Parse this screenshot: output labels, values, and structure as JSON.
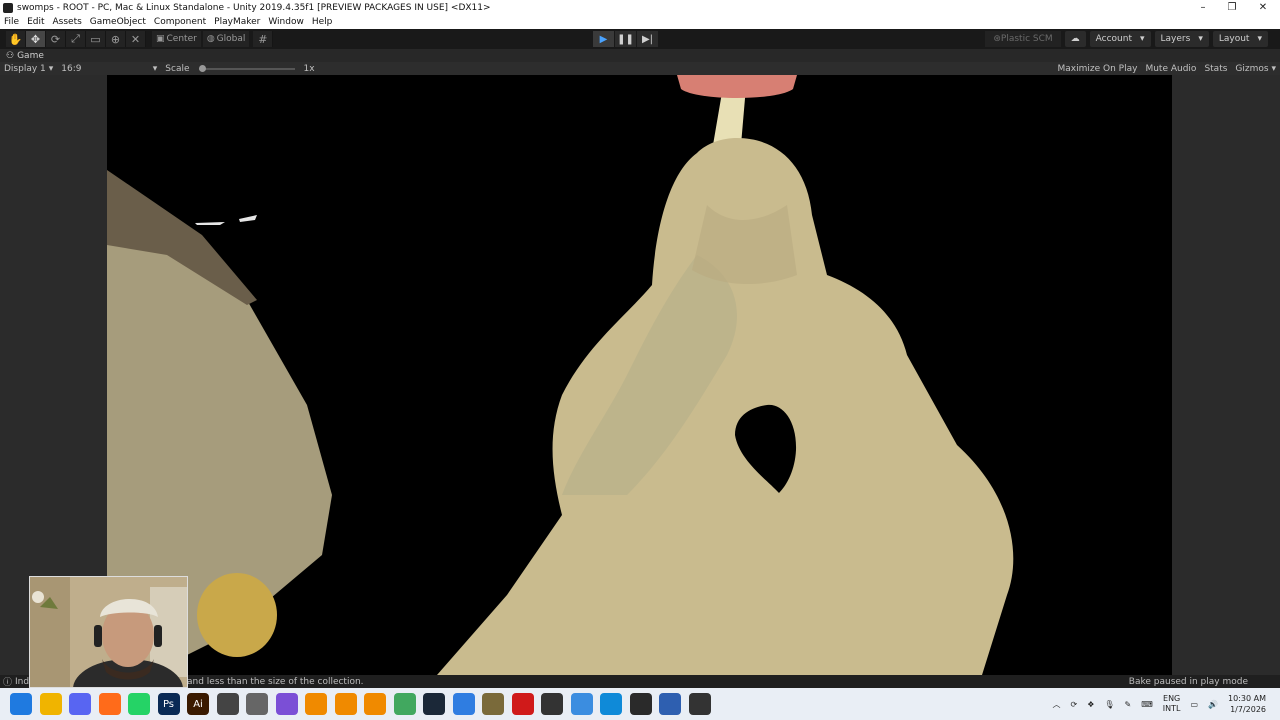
{
  "window": {
    "title": "swomps - ROOT - PC, Mac & Linux Standalone - Unity 2019.4.35f1 [PREVIEW PACKAGES IN USE] <DX11>",
    "controls": [
      "–",
      "❐",
      "✕"
    ]
  },
  "menu": [
    "File",
    "Edit",
    "Assets",
    "GameObject",
    "Component",
    "PlayMaker",
    "Window",
    "Help"
  ],
  "toolbar": {
    "tools": [
      "hand-icon",
      "move-icon",
      "rotate-icon",
      "scale-icon",
      "rect-icon",
      "transform-icon",
      "custom-tool-icon"
    ],
    "pivot": "Center",
    "space": "Global",
    "plastic_scm": "Plastic SCM",
    "account": "Account",
    "layers": "Layers",
    "layout": "Layout"
  },
  "play_mode": {
    "playing": true,
    "paused": false
  },
  "game_tab": {
    "label": "Game"
  },
  "game_bar": {
    "display": "Display 1",
    "aspect": "16:9",
    "scale_label": "Scale",
    "scale_value": "1x",
    "maximize": "Maximize On Play",
    "mute": "Mute Audio",
    "stats": "Stats",
    "gizmos": "Gizmos"
  },
  "status": {
    "message_prefix": "Inde",
    "message": "and less than the size of the collection.",
    "right": "Bake paused in play mode"
  },
  "taskbar": {
    "apps": [
      {
        "name": "start",
        "color": "#1f7ae0"
      },
      {
        "name": "file-explorer",
        "color": "#f0b400"
      },
      {
        "name": "discord",
        "color": "#5865f2"
      },
      {
        "name": "firefox",
        "color": "#ff6b1a"
      },
      {
        "name": "whatsapp",
        "color": "#25d366"
      },
      {
        "name": "photoshop",
        "color": "#0a2a55",
        "label": "Ps"
      },
      {
        "name": "illustrator",
        "color": "#3a1a00",
        "label": "Ai"
      },
      {
        "name": "unity-hub",
        "color": "#444444"
      },
      {
        "name": "unity",
        "color": "#666666"
      },
      {
        "name": "app-purple",
        "color": "#7b4fd6"
      },
      {
        "name": "blender",
        "color": "#f08a00"
      },
      {
        "name": "blender-2",
        "color": "#f08a00"
      },
      {
        "name": "blender-3",
        "color": "#f08a00"
      },
      {
        "name": "app-green",
        "color": "#41a85f"
      },
      {
        "name": "steam",
        "color": "#1b2838"
      },
      {
        "name": "notepad",
        "color": "#2f7de1"
      },
      {
        "name": "app-bug",
        "color": "#7a6a3a"
      },
      {
        "name": "record",
        "color": "#d01a1a"
      },
      {
        "name": "media",
        "color": "#333333"
      },
      {
        "name": "chrome",
        "color": "#3b8de0"
      },
      {
        "name": "edge",
        "color": "#0f8ad8"
      },
      {
        "name": "terminal",
        "color": "#2a2a2a"
      },
      {
        "name": "app-bolt",
        "color": "#2e5fb0"
      },
      {
        "name": "visual-studio",
        "color": "#333333"
      }
    ],
    "tray": {
      "lang1": "ENG",
      "lang2": "INTL",
      "time": "10:30 AM",
      "date": "1/7/2026"
    }
  },
  "colors": {
    "editor_bg": "#1e1e1e",
    "accent_play": "#4aa3ff",
    "character": "#c9bb8e",
    "mushroom_cap": "#d77f73"
  }
}
